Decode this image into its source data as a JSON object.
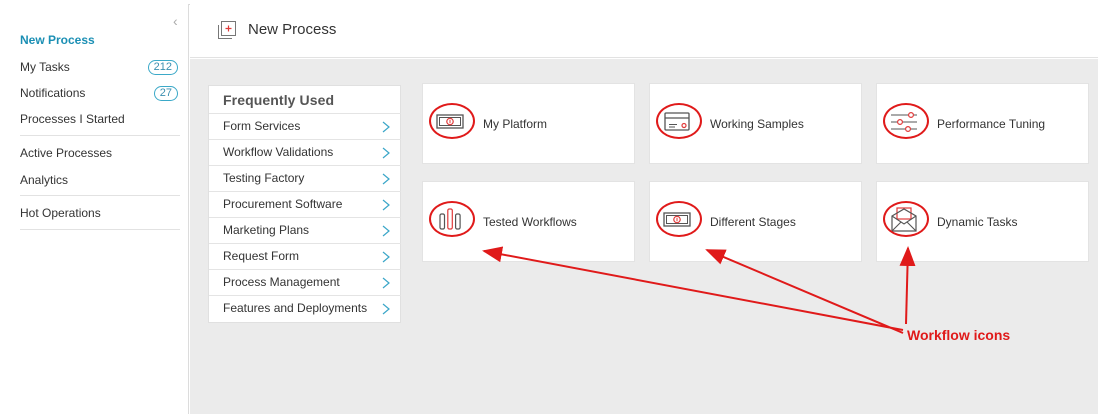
{
  "sidebar": {
    "items": [
      {
        "label": "New Process",
        "active": true
      },
      {
        "label": "My Tasks",
        "badge": "212"
      },
      {
        "label": "Notifications",
        "badge": "27"
      },
      {
        "label": "Processes I Started"
      },
      {
        "label": "Active Processes"
      },
      {
        "label": "Analytics"
      },
      {
        "label": "Hot Operations"
      }
    ]
  },
  "header": {
    "title": "New Process",
    "icon": "new-process-icon"
  },
  "frequently_used": {
    "title": "Frequently Used",
    "items": [
      "Form Services",
      "Workflow Validations",
      "Testing Factory",
      "Procurement Software",
      "Marketing Plans",
      "Request Form",
      "Process Management",
      "Features and Deployments"
    ]
  },
  "tiles": [
    {
      "label": "My Platform",
      "icon": "money-icon"
    },
    {
      "label": "Working Samples",
      "icon": "card-icon"
    },
    {
      "label": "Performance Tuning",
      "icon": "sliders-icon"
    },
    {
      "label": "Tested Workflows",
      "icon": "bars-icon"
    },
    {
      "label": "Different Stages",
      "icon": "money-icon"
    },
    {
      "label": "Dynamic Tasks",
      "icon": "envelope-icon"
    }
  ],
  "annotation": {
    "label": "Workflow icons",
    "color": "#e01a1a"
  },
  "colors": {
    "accent": "#1b8fb4",
    "main_bg": "#ebebeb",
    "icon_red": "#e03a3a"
  }
}
